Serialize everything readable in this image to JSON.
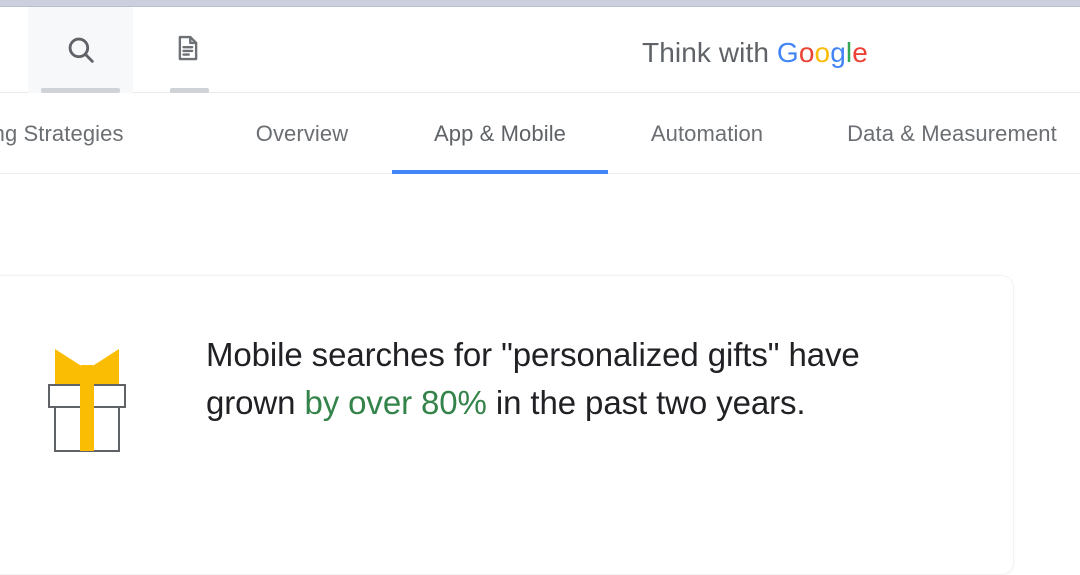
{
  "browser": {
    "chrome_strip_color": "#ccd0dc"
  },
  "header": {
    "tabs": [
      {
        "name": "search",
        "icon": "search-icon",
        "active": true
      },
      {
        "name": "articles",
        "icon": "document-icon",
        "active": false
      }
    ],
    "brand": {
      "prefix": "Think with ",
      "logo_letters": [
        {
          "char": "G",
          "color": "#4285F4"
        },
        {
          "char": "o",
          "color": "#EA4335"
        },
        {
          "char": "o",
          "color": "#FBBC04"
        },
        {
          "char": "g",
          "color": "#4285F4"
        },
        {
          "char": "l",
          "color": "#34A853"
        },
        {
          "char": "e",
          "color": "#EA4335"
        }
      ],
      "full_text": "Think with Google"
    }
  },
  "nav": {
    "active_indicator_color": "#4285F4",
    "items": [
      {
        "label": "keting Strategies",
        "active": false,
        "truncated": true
      },
      {
        "label": "Overview",
        "active": false
      },
      {
        "label": "App & Mobile",
        "active": true
      },
      {
        "label": "Automation",
        "active": false
      },
      {
        "label": "Data & Measurement",
        "active": false
      }
    ]
  },
  "card": {
    "icon": "gift-box-icon",
    "icon_colors": {
      "ribbon": "#FBBC04",
      "box_outline": "#5f6368"
    },
    "highlight_color": "#34834a",
    "text": {
      "part1": "Mobile searches for \"personalized gifts\" have grown ",
      "highlight": "by over 80%",
      "part2": " in the past two years."
    },
    "full_text": "Mobile searches for \"personalized gifts\" have grown by over 80% in the past two years."
  }
}
